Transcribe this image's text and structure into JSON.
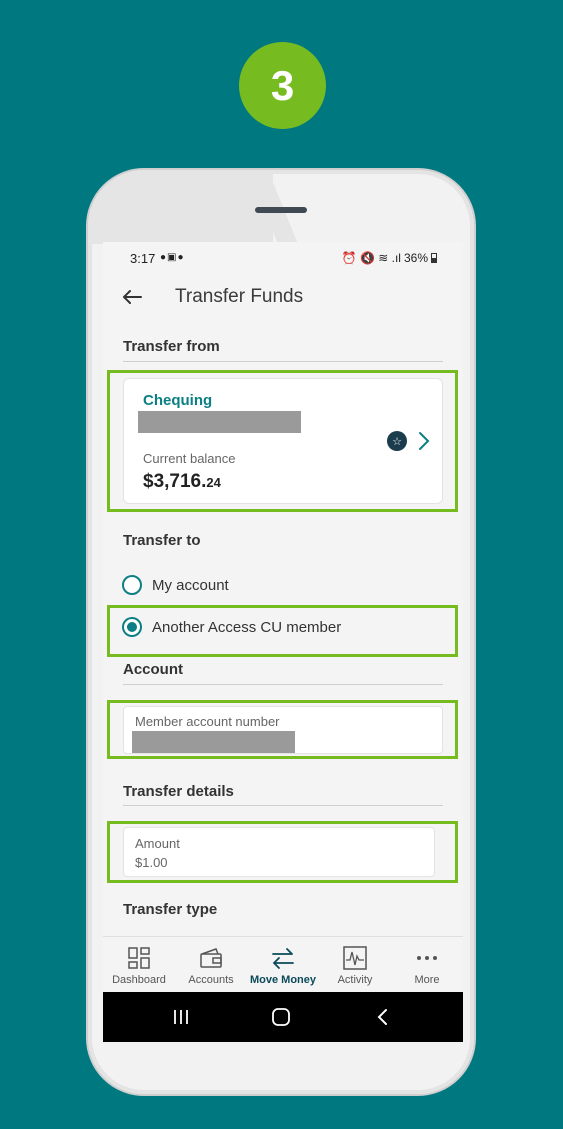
{
  "step": "3",
  "status": {
    "time": "3:17",
    "left_icons": "●▣●",
    "right_icons": "⏰ 🔇 ≋ .ıl",
    "battery": "36%"
  },
  "header": {
    "title": "Transfer Funds"
  },
  "transfer_from": {
    "heading": "Transfer from",
    "account_name": "Chequing",
    "balance_label": "Current balance",
    "balance_main": "$3,716.",
    "balance_cents": "24"
  },
  "transfer_to": {
    "heading": "Transfer to",
    "options": [
      {
        "label": "My account",
        "selected": false
      },
      {
        "label": "Another Access CU member",
        "selected": true
      }
    ]
  },
  "account": {
    "heading": "Account",
    "field_label": "Member account number"
  },
  "details": {
    "heading": "Transfer details",
    "amount_label": "Amount",
    "amount_value": "$1.00"
  },
  "transfer_type": {
    "heading": "Transfer type"
  },
  "nav": {
    "items": [
      {
        "label": "Dashboard",
        "icon": "dashboard-icon"
      },
      {
        "label": "Accounts",
        "icon": "wallet-icon"
      },
      {
        "label": "Move Money",
        "icon": "transfer-arrows-icon",
        "active": true
      },
      {
        "label": "Activity",
        "icon": "activity-chart-icon"
      },
      {
        "label": "More",
        "icon": "more-dots-icon"
      }
    ]
  },
  "colors": {
    "background": "#007880",
    "highlight": "#76bc21",
    "accent": "#0b7f84"
  }
}
